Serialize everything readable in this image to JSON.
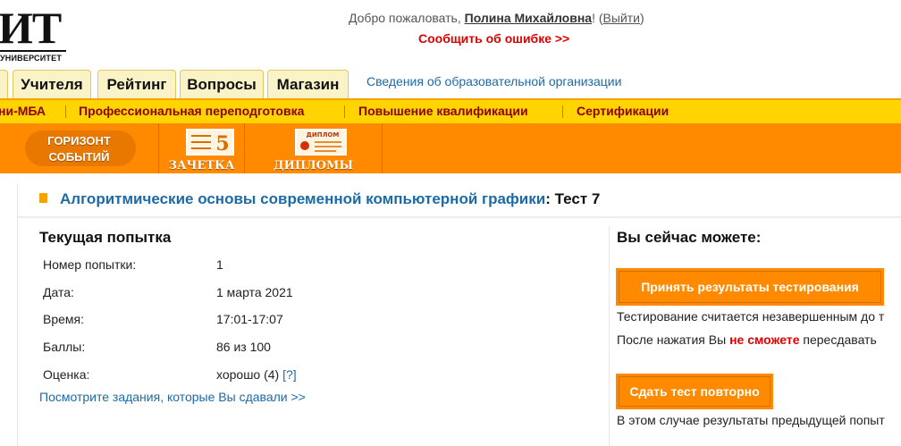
{
  "header": {
    "logo_big": "ИТ",
    "logo_small": "УНИВЕРСИТЕТ",
    "welcome_prefix": "Добро пожаловать, ",
    "user_name": "Полина Михайловна",
    "welcome_bang": "!",
    "logout_open": " (",
    "logout_label": "Выйти",
    "logout_close": ")",
    "report_error": "Сообщить об ошибке >>"
  },
  "tabs": [
    "",
    "Учителя",
    "Рейтинг",
    "Вопросы",
    "Магазин"
  ],
  "edu_link": "Сведения об образовательной организации",
  "yellow_nav": [
    "ни-МБА",
    "Профессиональная переподготовка",
    "Повышение квалификации",
    "Сертификации"
  ],
  "banners": {
    "horizon_line1": "ГОРИЗОНТ",
    "horizon_line2": "СОБЫТИЙ",
    "zachetka_digit": "5",
    "zachetka": "ЗАЧЕТКА",
    "diploma_tag": "ДИПЛОМ",
    "diplomas": "ДИПЛОМЫ"
  },
  "page": {
    "course": "Алгоритмические основы современной компьютерной графики",
    "colon": ":",
    "test": " Тест 7"
  },
  "attempt": {
    "heading": "Текущая попытка",
    "rows": [
      {
        "label": "Номер попытки:",
        "value": "1"
      },
      {
        "label": "Дата:",
        "value": "1 марта 2021"
      },
      {
        "label": "Время:",
        "value": "17:01-17:07"
      },
      {
        "label": "Баллы:",
        "value": "86 из 100"
      },
      {
        "label": "Оценка:",
        "value": "хорошо (4)"
      }
    ],
    "help": "[?]",
    "tasks_link": "Посмотрите задания, которые Вы сдавали >>"
  },
  "actions": {
    "heading": "Вы сейчас можете:",
    "accept_button": "Принять результаты тестирования",
    "note1": "Тестирование считается незавершенным до т",
    "note2_prefix": "После нажатия Вы ",
    "note2_warn": "не сможете",
    "note2_suffix": " пересдавать",
    "retake_button": "Сдать тест повторно",
    "note3": "В этом случае результаты предыдущей попыт"
  },
  "colors": {
    "orange": "#ff8a00",
    "yellow": "#ffd400",
    "link_blue": "#1d6aa6",
    "alert_red": "#e00000",
    "nav_red": "#8b0000"
  }
}
